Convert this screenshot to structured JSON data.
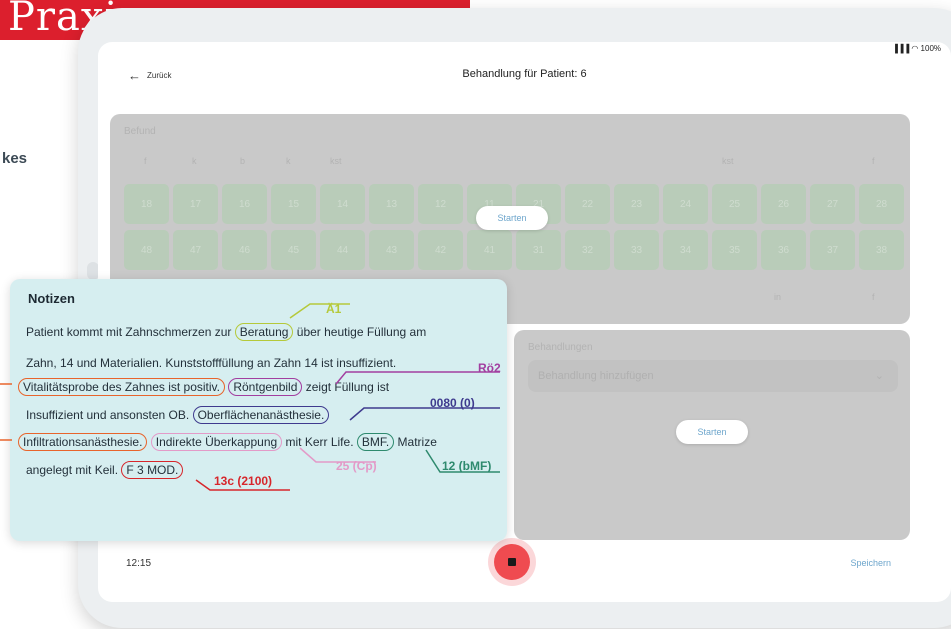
{
  "banner": {
    "title": "Praxisprozesse"
  },
  "side_text": "kes",
  "status": {
    "indicators": "▐▐▐ ◠ 100%"
  },
  "header": {
    "back_label": "Zurück",
    "title": "Behandlung für Patient: 6"
  },
  "befund": {
    "label": "Befund",
    "header_left": [
      "f",
      "k",
      "b",
      "k",
      "kst"
    ],
    "header_right": [
      "kst",
      "f"
    ],
    "upper_teeth": [
      "18",
      "17",
      "16",
      "15",
      "14",
      "13",
      "12",
      "11",
      "21",
      "22",
      "23",
      "24",
      "25",
      "26",
      "27",
      "28"
    ],
    "lower_teeth": [
      "48",
      "47",
      "46",
      "45",
      "44",
      "43",
      "42",
      "41",
      "31",
      "32",
      "33",
      "34",
      "35",
      "36",
      "37",
      "38"
    ],
    "bottom_labels": [
      "in",
      "f"
    ],
    "start_label": "Starten"
  },
  "behandlungen": {
    "label": "Behandlungen",
    "placeholder": "Behandlung hinzufügen",
    "start_label": "Starten"
  },
  "footer": {
    "time": "12:15",
    "save_label": "Speichern"
  },
  "notes": {
    "title": "Notizen",
    "line1": {
      "a": "Patient kommt mit Zahnschmerzen zur ",
      "box1": "Beratung",
      "b": " über heutige Füllung am"
    },
    "line2": "Zahn, 14 und Materialien. Kunststofffüllung an Zahn 14 ist insuffizient.",
    "line3": {
      "box1": "Vitalitätsprobe des Zahnes ist positiv.",
      "box2": "Röntgenbild",
      "b": " zeigt Füllung ist"
    },
    "line4": {
      "a": "Insuffizient und ansonsten OB. ",
      "box1": "Oberflächenanästhesie."
    },
    "line5": {
      "box1": "Infiltrationsanästhesie.",
      "box2": "Indirekte Überkappung",
      "b": " mit Kerr Life. ",
      "box3": "BMF.",
      "c": " Matrize"
    },
    "line6": {
      "a": "angelegt mit Keil. ",
      "box1": "F 3 MOD."
    },
    "tags": {
      "a1": "Ä1",
      "ro2": "Rö2",
      "t0080": "0080 (0)",
      "t25": "25 (Cp)",
      "t12": "12 (bMF)",
      "t13c": "13c (2100)"
    }
  },
  "colors": {
    "brand_red": "#dc1f2d",
    "beratung": "#b5c93a",
    "roentgen": "#a23ea0",
    "oberflaeche": "#3e3a8e",
    "vitalitaet": "#e8642c",
    "infiltration": "#e8642c",
    "ueberkappung": "#e39ac8",
    "bmf": "#2e8a6e",
    "fmod": "#d7262b"
  }
}
